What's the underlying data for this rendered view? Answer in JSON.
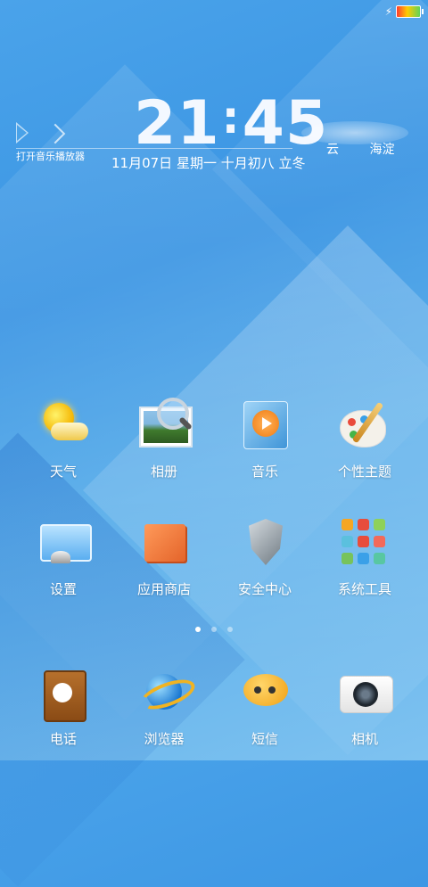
{
  "status_bar": {
    "charging_icon": "bolt-icon",
    "battery_icon": "battery-icon"
  },
  "clock_widget": {
    "music_label": "打开音乐播放器",
    "time_hours": "21",
    "time_sep": ":",
    "time_minutes": "45",
    "date_line": "11月07日  星期一  十月初八 立冬",
    "weather": "云",
    "city": "海淀"
  },
  "apps": [
    {
      "label": "天气",
      "icon": "weather-icon"
    },
    {
      "label": "相册",
      "icon": "gallery-icon"
    },
    {
      "label": "音乐",
      "icon": "music-icon"
    },
    {
      "label": "个性主题",
      "icon": "theme-palette-icon"
    },
    {
      "label": "设置",
      "icon": "settings-icon"
    },
    {
      "label": "应用商店",
      "icon": "app-store-icon"
    },
    {
      "label": "安全中心",
      "icon": "security-shield-icon"
    },
    {
      "label": "系统工具",
      "icon": "system-tools-icon"
    }
  ],
  "pager": {
    "pages": 3,
    "current": 1
  },
  "dock": [
    {
      "label": "电话",
      "icon": "phone-icon"
    },
    {
      "label": "浏览器",
      "icon": "browser-icon"
    },
    {
      "label": "短信",
      "icon": "messages-icon"
    },
    {
      "label": "相机",
      "icon": "camera-icon"
    }
  ]
}
